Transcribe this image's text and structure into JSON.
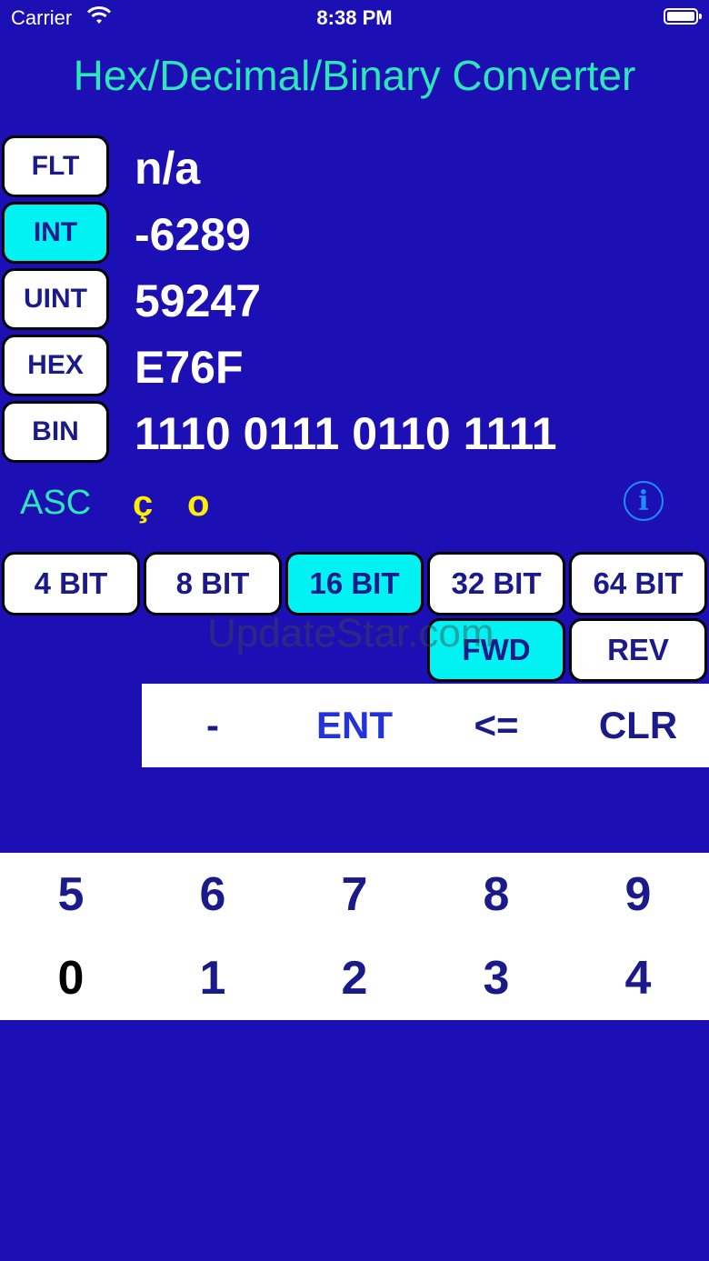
{
  "status_bar": {
    "carrier": "Carrier",
    "time": "8:38 PM"
  },
  "title": "Hex/Decimal/Binary Converter",
  "types": [
    {
      "label": "FLT",
      "value": "n/a"
    },
    {
      "label": "INT",
      "value": "-6289",
      "active": true
    },
    {
      "label": "UINT",
      "value": "59247"
    },
    {
      "label": "HEX",
      "value": "E76F"
    },
    {
      "label": "BIN",
      "value": "1110 0111 0110 1111"
    }
  ],
  "ascii": {
    "label": "ASC",
    "char1": "ç",
    "char2": "o"
  },
  "bit_sizes": [
    "4 BIT",
    "8 BIT",
    "16 BIT",
    "32 BIT",
    "64 BIT"
  ],
  "selected_bits": "16 BIT",
  "order": {
    "fwd": "FWD",
    "rev": "REV",
    "selected": "FWD"
  },
  "watermark": "UpdateStar.com",
  "ops": {
    "minus": "-",
    "enter": "ENT",
    "backspace": "<=",
    "clear": "CLR"
  },
  "keys_row1": [
    "5",
    "6",
    "7",
    "8",
    "9"
  ],
  "keys_row2": [
    "0",
    "1",
    "2",
    "3",
    "4"
  ],
  "icons": {
    "wifi": "wifi-icon",
    "battery": "battery-icon",
    "info": "info-icon"
  },
  "colors": {
    "background": "#1c10b5",
    "accent": "#00f2f2",
    "title": "#2ee6b8",
    "ascii": "#ffee00",
    "info": "#1f8cff"
  }
}
